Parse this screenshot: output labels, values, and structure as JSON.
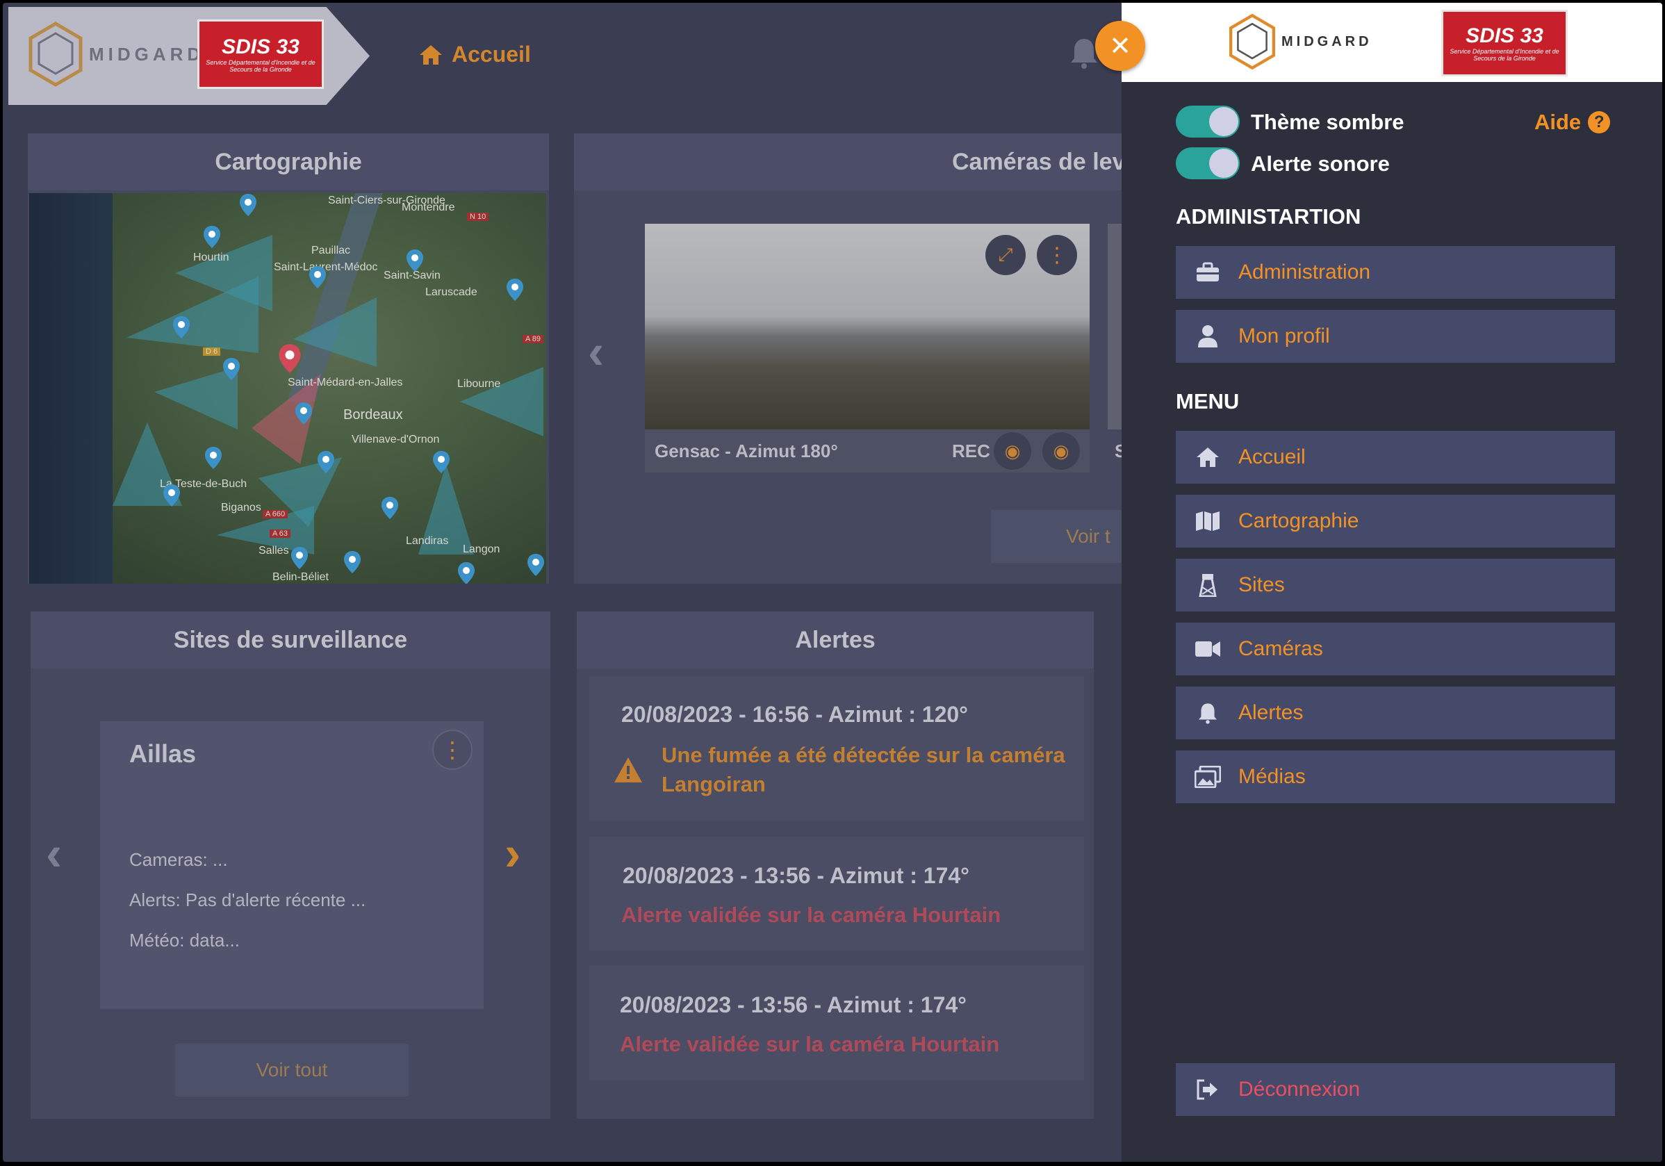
{
  "header": {
    "brand": "MIDGARD",
    "sdis_logo": "SDIS 33",
    "sdis_caption": "Service Départemental d'Incendie et de Secours de la Gironde",
    "breadcrumb": "Accueil"
  },
  "cartographie": {
    "title": "Cartographie",
    "places": [
      "Saint-Ciers-sur-Gironde",
      "Montendre",
      "N 10",
      "Hourtin",
      "Pauillac",
      "Saint-Laurent-Médoc",
      "Saint-Savin",
      "Laruscade",
      "D 6",
      "A 89",
      "Saint-Médard-en-Jalles",
      "Libourne",
      "Bordeaux",
      "Villenave-d'Ornon",
      "La Teste-de-Buch",
      "Biganos",
      "A 660",
      "A 63",
      "Langon",
      "Landiras",
      "Belin-Béliet",
      "Salles"
    ]
  },
  "cameras": {
    "title": "Caméras de lev",
    "current": {
      "name": "Gensac - Azimut 180°",
      "rec": "REC"
    },
    "next_initial": "S",
    "see_all": "Voir t"
  },
  "sites": {
    "title": "Sites de surveillance",
    "card": {
      "name": "Aillas",
      "cameras": "Cameras: ...",
      "alerts": "Alerts: Pas d'alerte récente ...",
      "meteo": "Météo: data..."
    },
    "see_all": "Voir tout"
  },
  "alertes": {
    "title": "Alertes",
    "items": [
      {
        "when": "20/08/2023 - 16:56 - Azimut : 120°",
        "message": "Une fumée a été détectée sur la caméra Langoiran",
        "status": "warning"
      },
      {
        "when": "20/08/2023 - 13:56 - Azimut : 174°",
        "message": "Alerte validée sur la caméra Hourtain",
        "status": "validated"
      },
      {
        "when": "20/08/2023 - 13:56 - Azimut : 174°",
        "message": "Alerte validée sur la caméra Hourtain",
        "status": "validated"
      }
    ]
  },
  "drawer": {
    "brand": "MIDGARD",
    "sdis_logo": "SDIS 33",
    "sdis_caption": "Service Départemental d'Incendie et de Secours de la Gironde",
    "toggles": [
      {
        "label": "Thème sombre",
        "on": true
      },
      {
        "label": "Alerte sonore",
        "on": true
      }
    ],
    "help": "Aide",
    "admin_section": "ADMINISTARTION",
    "admin_items": [
      {
        "label": "Administration",
        "icon": "toolbox-icon"
      },
      {
        "label": "Mon profil",
        "icon": "user-icon"
      }
    ],
    "menu_section": "MENU",
    "menu_items": [
      {
        "label": "Accueil",
        "icon": "home-icon"
      },
      {
        "label": "Cartographie",
        "icon": "map-icon"
      },
      {
        "label": "Sites",
        "icon": "tower-icon"
      },
      {
        "label": "Caméras",
        "icon": "video-camera-icon"
      },
      {
        "label": "Alertes",
        "icon": "bell-icon"
      },
      {
        "label": "Médias",
        "icon": "images-icon"
      }
    ],
    "logout": {
      "label": "Déconnexion",
      "icon": "logout-icon"
    }
  },
  "colors": {
    "accent": "#f39224",
    "danger": "#e9505f",
    "toggle_on": "#2aa39a",
    "nav_bg": "#454a6b",
    "drawer_bg": "#2d2f3d"
  }
}
